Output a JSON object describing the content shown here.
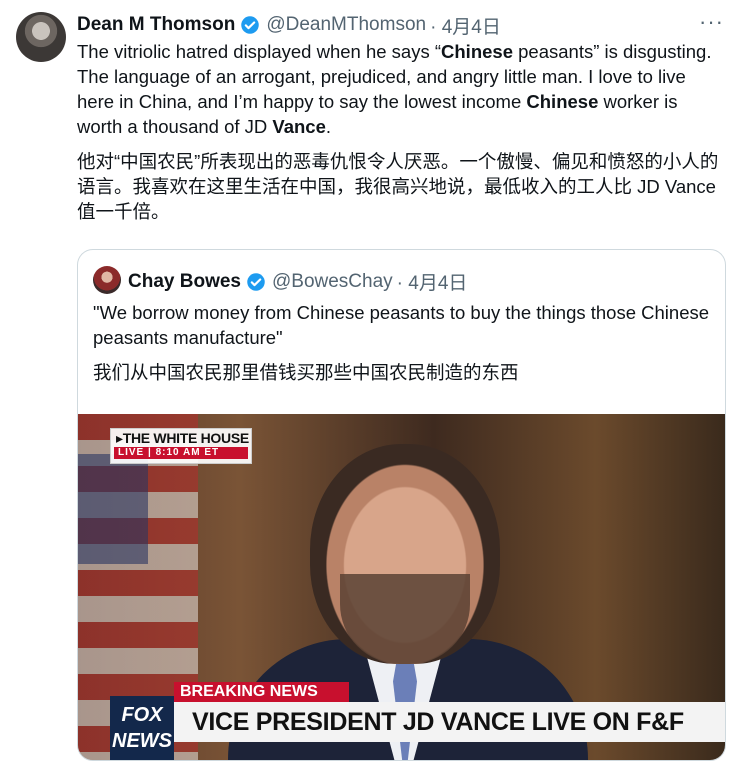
{
  "tweet": {
    "author": "Dean M Thomson",
    "handle": "@DeanMThomson",
    "date": "· 4月4日",
    "more": "···",
    "text_en": {
      "p1": "The vitriolic hatred displayed when he says “",
      "b1": "Chinese",
      "p2": " peasants” is disgusting. The language of an arrogant, prejudiced, and angry little man. I love to live here in China, and I’m happy to say the lowest income ",
      "b2": "Chinese",
      "p3": " worker is worth a thousand of JD ",
      "b3": "Vance",
      "p4": "."
    },
    "text_zh": "他对“中国农民”所表现出的恶毒仇恨令人厌恶。一个傲慢、偏见和愤怒的小人的语言。我喜欢在这里生活在中国，我很高兴地说，最低收入的工人比 JD Vance 值一千倍。"
  },
  "quote": {
    "author": "Chay Bowes",
    "handle": "@BowesChay",
    "date": "· 4月4日",
    "text_en": "\"We borrow money from Chinese peasants to buy the things those Chinese peasants manufacture\"",
    "text_zh": "我们从中国农民那里借钱买那些中国农民制造的东西",
    "video": {
      "bug_line1": "▸THE WHITE HOUSE",
      "bug_line2": "LIVE | 8:10 AM ET",
      "breaking": "BREAKING NEWS",
      "lower_third": "VICE PRESIDENT JD VANCE LIVE ON F&F",
      "network": "FOX NEWS"
    }
  },
  "colors": {
    "verified": "#1d9bf0",
    "muted": "#536471",
    "border": "#cfd9de"
  },
  "icons": {
    "verified": "verified-badge-icon",
    "more": "more-icon"
  }
}
